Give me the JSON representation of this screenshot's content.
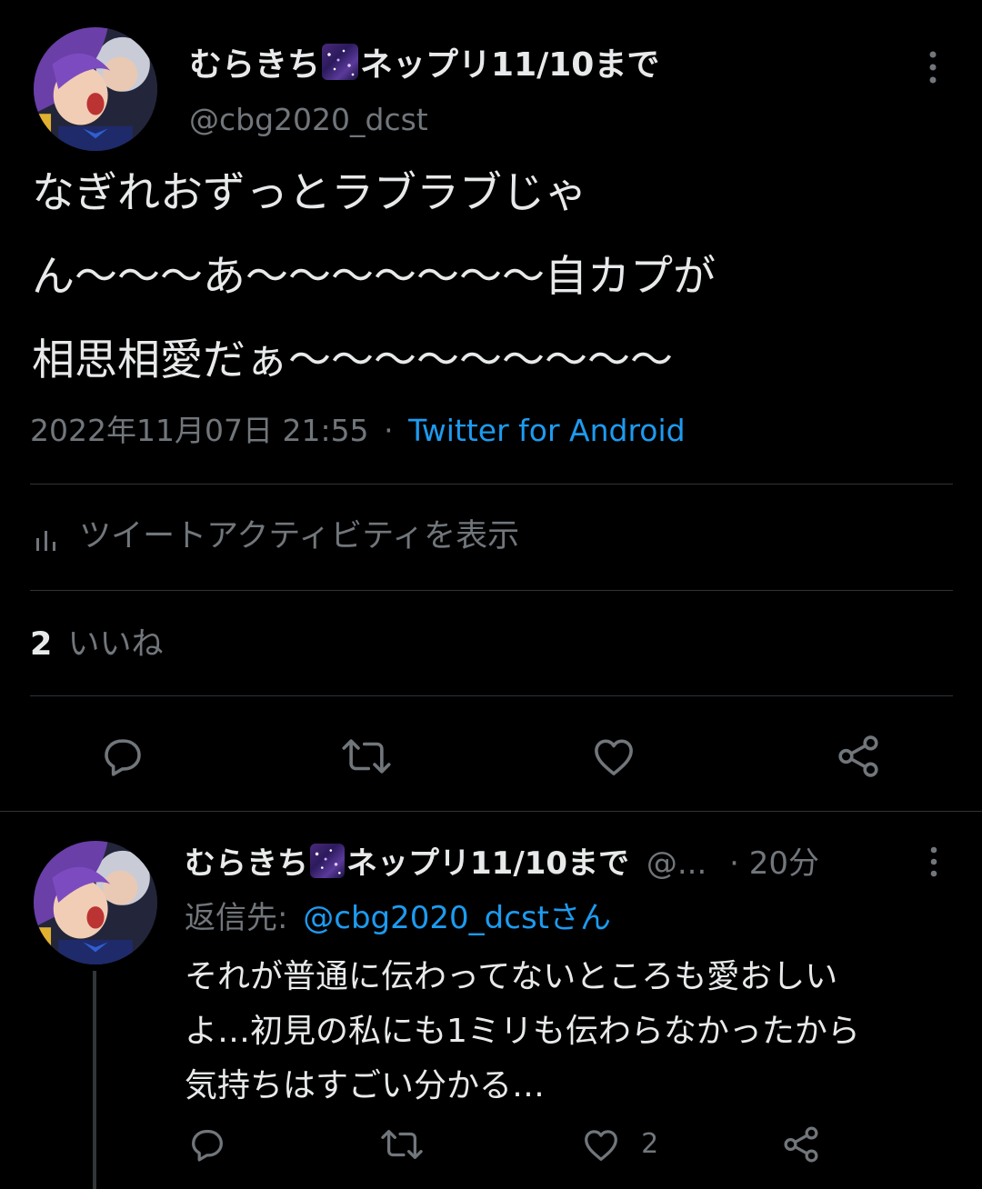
{
  "main_tweet": {
    "display_name": "むらきち",
    "display_name_suffix": "ネップリ11/10まで",
    "handle": "@cbg2020_dcst",
    "text_lines": [
      "なぎれおずっとラブラブじゃ",
      "ん〜〜〜あ〜〜〜〜〜〜〜自カプが",
      "相思相愛だぁ〜〜〜〜〜〜〜〜〜"
    ],
    "timestamp": "2022年11月07日 21:55",
    "separator": "·",
    "source": "Twitter for Android",
    "activity_label": "ツイートアクティビティを表示",
    "likes_count": "2",
    "likes_label": "いいね"
  },
  "reply_tweet": {
    "display_name": "むらきち",
    "display_name_suffix": "ネップリ11/10まで",
    "handle_truncated": "@...",
    "time": "· 20分",
    "reply_to_prefix": "返信先:",
    "reply_to_handle": "@cbg2020_dcstさん",
    "text_lines": [
      "それが普通に伝わってないところも愛おしい",
      "よ…初見の私にも1ミリも伝わらなかったから",
      "気持ちはすごい分かる…"
    ],
    "like_count": "2"
  },
  "icons": {
    "more": "more-vertical-icon",
    "activity": "bar-chart-icon",
    "reply": "reply-icon",
    "retweet": "retweet-icon",
    "like": "heart-icon",
    "share": "share-icon"
  },
  "colors": {
    "background": "#000000",
    "text": "#e7e9ea",
    "muted": "#71767b",
    "link": "#1d9bf0",
    "divider": "#2f3336"
  }
}
